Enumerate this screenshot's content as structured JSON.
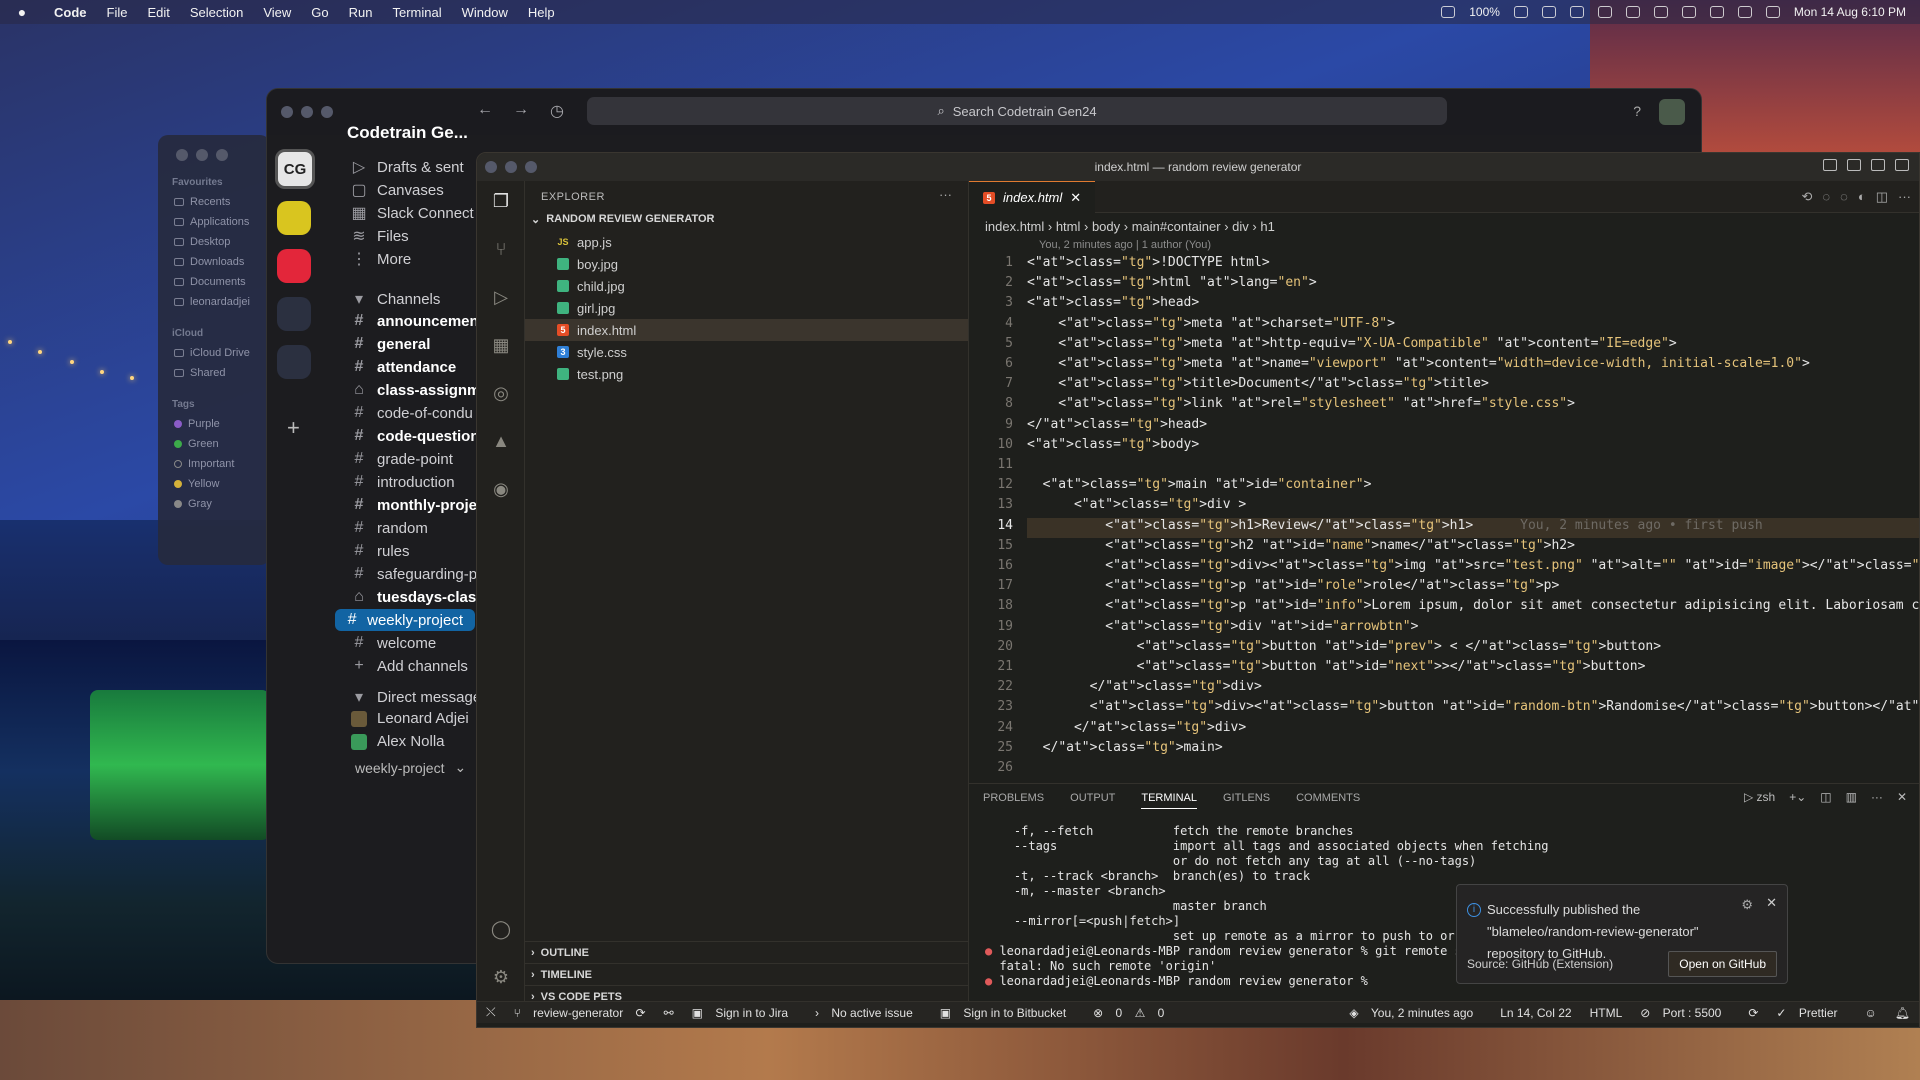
{
  "menubar": {
    "app": "Code",
    "items": [
      "File",
      "Edit",
      "Selection",
      "View",
      "Go",
      "Run",
      "Terminal",
      "Window",
      "Help"
    ],
    "battery": "100%",
    "datetime": "Mon 14 Aug  6:10 PM"
  },
  "finder": {
    "favourites_label": "Favourites",
    "favourites": [
      "Recents",
      "Applications",
      "Desktop",
      "Downloads",
      "Documents",
      "leonardadjei"
    ],
    "icloud_label": "iCloud",
    "icloud": [
      "iCloud Drive",
      "Shared"
    ],
    "tags_label": "Tags",
    "tags": [
      {
        "label": "Purple",
        "color": "#8a5cc7"
      },
      {
        "label": "Green",
        "color": "#3caa4a"
      },
      {
        "label": "Important",
        "color": "#888888"
      },
      {
        "label": "Yellow",
        "color": "#d4b13a"
      },
      {
        "label": "Gray",
        "color": "#888888"
      }
    ]
  },
  "slack": {
    "search_placeholder": "Search Codetrain Gen24",
    "workspace_initials": "CG",
    "workspace_name": "Codetrain Ge...",
    "nav": [
      "Drafts & sent",
      "Canvases",
      "Slack Connect",
      "Files",
      "More"
    ],
    "channels_label": "Channels",
    "channels": [
      {
        "name": "announcement",
        "bold": true,
        "lock": false
      },
      {
        "name": "general",
        "bold": true,
        "lock": false
      },
      {
        "name": "attendance",
        "bold": true,
        "lock": false
      },
      {
        "name": "class-assignme",
        "bold": true,
        "lock": true
      },
      {
        "name": "code-of-condu",
        "bold": false,
        "lock": false
      },
      {
        "name": "code-questions",
        "bold": true,
        "lock": false
      },
      {
        "name": "grade-point",
        "bold": false,
        "lock": false
      },
      {
        "name": "introduction",
        "bold": false,
        "lock": false
      },
      {
        "name": "monthly-projec",
        "bold": true,
        "lock": false
      },
      {
        "name": "random",
        "bold": false,
        "lock": false
      },
      {
        "name": "rules",
        "bold": false,
        "lock": false
      },
      {
        "name": "safeguarding-p",
        "bold": false,
        "lock": false
      },
      {
        "name": "tuesdays-class-",
        "bold": true,
        "lock": true
      },
      {
        "name": "weekly-project",
        "bold": false,
        "lock": false,
        "selected": true
      },
      {
        "name": "welcome",
        "bold": false,
        "lock": false
      }
    ],
    "add_channels": "Add channels",
    "dm_label": "Direct message",
    "dms": [
      "Leonard Adjei",
      "Alex Nolla"
    ],
    "bottom_channel": "weekly-project"
  },
  "vscode": {
    "title": "index.html — random review generator",
    "explorer_label": "EXPLORER",
    "project": "RANDOM REVIEW GENERATOR",
    "files": [
      {
        "name": "app.js",
        "icon": "JS",
        "color": "#d9c23a"
      },
      {
        "name": "boy.jpg",
        "icon": "img",
        "color": "#3fb37f"
      },
      {
        "name": "child.jpg",
        "icon": "img",
        "color": "#3fb37f"
      },
      {
        "name": "girl.jpg",
        "icon": "img",
        "color": "#3fb37f"
      },
      {
        "name": "index.html",
        "icon": "5",
        "color": "#e44d26",
        "selected": true
      },
      {
        "name": "style.css",
        "icon": "3",
        "color": "#2f7fd6"
      },
      {
        "name": "test.png",
        "icon": "img",
        "color": "#3fb37f"
      }
    ],
    "outline": "OUTLINE",
    "timeline": "TIMELINE",
    "pets": "VS CODE PETS",
    "tab": "index.html",
    "breadcrumbs": [
      "index.html",
      "html",
      "body",
      "main#container",
      "div",
      "h1"
    ],
    "blame_header": "You, 2 minutes ago | 1 author (You)",
    "current_line": 14,
    "inline_blame": "You, 2 minutes ago • first push",
    "code_lines": [
      "<!DOCTYPE html>",
      "<html lang=\"en\">",
      "<head>",
      "    <meta charset=\"UTF-8\">",
      "    <meta http-equiv=\"X-UA-Compatible\" content=\"IE=edge\">",
      "    <meta name=\"viewport\" content=\"width=device-width, initial-scale=1.0\">",
      "    <title>Document</title>",
      "    <link rel=\"stylesheet\" href=\"style.css\">",
      "</head>",
      "<body>",
      "",
      "  <main id=\"container\">",
      "      <div >",
      "          <h1>Review</h1>",
      "          <h2 id=\"name\">name</h2>",
      "          <div><img src=\"test.png\" alt=\"\" id=\"image\"></div>",
      "          <p id=\"role\">role</p>",
      "          <p id=\"info\">Lorem ipsum, dolor sit amet consectetur adipisicing elit. Laboriosam cum, nulla ab",
      "          <div id=\"arrowbtn\">",
      "              <button id=\"prev\"> < </button>",
      "              <button id=\"next\">></button>",
      "        </div>",
      "        <div><button id=\"random-btn\">Randomise</button></div>",
      "      </div>",
      "  </main>",
      ""
    ],
    "panel_tabs": [
      "PROBLEMS",
      "OUTPUT",
      "TERMINAL",
      "GITLENS",
      "COMMENTS"
    ],
    "active_panel": "TERMINAL",
    "shell": "zsh",
    "terminal_lines": [
      "    -f, --fetch           fetch the remote branches",
      "    --tags                import all tags and associated objects when fetching",
      "                          or do not fetch any tag at all (--no-tags)",
      "    -t, --track <branch>  branch(es) to track",
      "    -m, --master <branch>",
      "                          master branch",
      "    --mirror[=<push|fetch>]",
      "                          set up remote as a mirror to push to or f",
      "",
      "leonardadjei@Leonards-MBP random review generator % git remote set-",
      "fatal: No such remote 'origin'",
      "leonardadjei@Leonards-MBP random review generator % "
    ],
    "toast": {
      "message": "Successfully published the \"blameleo/random-review-generator\" repository to GitHub.",
      "source": "Source: GitHub (Extension)",
      "button": "Open on GitHub"
    },
    "status": {
      "branch": "review-generator",
      "jira": "Sign in to Jira",
      "issue": "No active issue",
      "bitbucket": "Sign in to Bitbucket",
      "errors": "0",
      "warnings": "0",
      "blame": "You, 2 minutes ago",
      "position": "Ln 14, Col 22",
      "language": "HTML",
      "port": "Port : 5500",
      "prettier": "Prettier"
    }
  }
}
